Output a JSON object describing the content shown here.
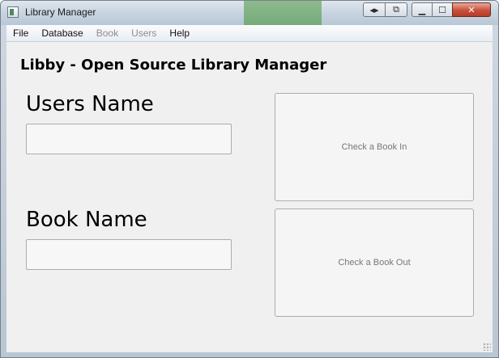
{
  "window": {
    "title": "Library Manager",
    "caption_buttons": {
      "minimize_glyph": "▁",
      "maximize_glyph": "☐",
      "close_glyph": "✕",
      "extra1_glyph": "◂▸",
      "extra2_glyph": "⧉"
    }
  },
  "menubar": {
    "items": [
      {
        "label": "File",
        "enabled": true
      },
      {
        "label": "Database",
        "enabled": true
      },
      {
        "label": "Book",
        "enabled": false
      },
      {
        "label": "Users",
        "enabled": false
      },
      {
        "label": "Help",
        "enabled": true
      }
    ]
  },
  "main": {
    "heading": "Libby - Open Source Library Manager",
    "users_label": "Users Name",
    "users_value": "",
    "book_label": "Book Name",
    "book_value": "",
    "check_in_label": "Check a Book In",
    "check_out_label": "Check a Book Out"
  },
  "icons": {
    "app": "app-window-icon",
    "grip": "size-grip-icon"
  },
  "colors": {
    "client_bg": "#f0f0f0",
    "close_button": "#c7503c",
    "button_text": "#777777"
  }
}
